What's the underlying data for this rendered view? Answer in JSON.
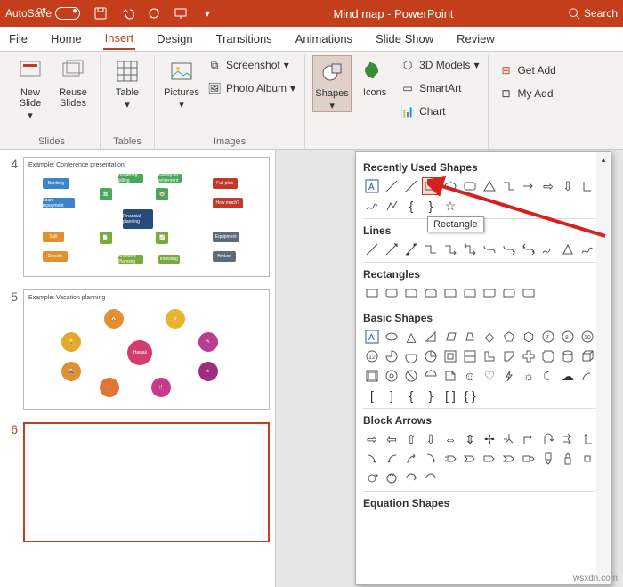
{
  "titlebar": {
    "autosave_label": "AutoSave",
    "autosave_state": "Off",
    "document_title": "Mind map - PowerPoint",
    "search_label": "Search"
  },
  "tabs": {
    "file": "File",
    "home": "Home",
    "insert": "Insert",
    "design": "Design",
    "transitions": "Transitions",
    "animations": "Animations",
    "slideshow": "Slide Show",
    "review": "Review"
  },
  "ribbon": {
    "slides": {
      "new_slide": "New Slide",
      "reuse": "Reuse Slides",
      "group": "Slides"
    },
    "tables": {
      "table": "Table",
      "group": "Tables"
    },
    "images": {
      "pictures": "Pictures",
      "screenshot": "Screenshot",
      "album": "Photo Album",
      "group": "Images"
    },
    "illus": {
      "shapes": "Shapes",
      "icons": "Icons",
      "models": "3D Models",
      "smartart": "SmartArt",
      "chart": "Chart"
    },
    "addins": {
      "get": "Get Add",
      "my": "My Add"
    }
  },
  "thumbs": {
    "s4": {
      "num": "4",
      "title": "Example: Conference presentation"
    },
    "s5": {
      "num": "5",
      "title": "Example: Vacation planning"
    },
    "s6": {
      "num": "6"
    }
  },
  "shapes_panel": {
    "recent": "Recently Used Shapes",
    "lines": "Lines",
    "rects": "Rectangles",
    "basic": "Basic Shapes",
    "arrows": "Block Arrows",
    "equation": "Equation Shapes",
    "tooltip": "Rectangle"
  },
  "watermark": "wsxdn.com"
}
